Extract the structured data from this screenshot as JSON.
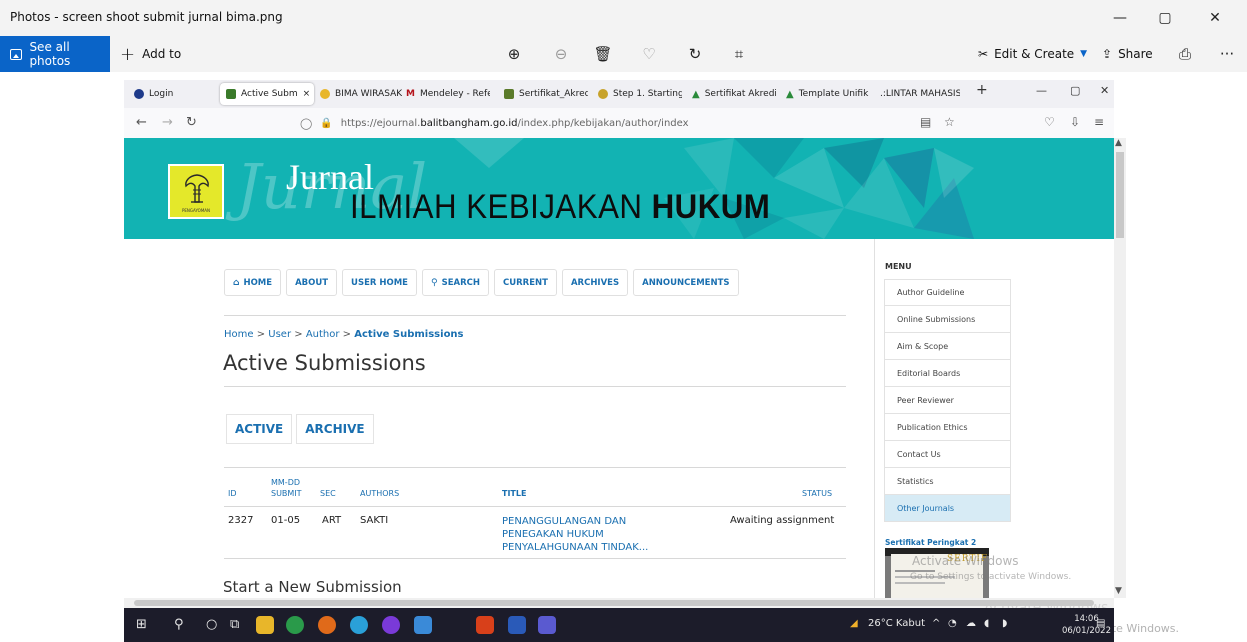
{
  "photos_app": {
    "title": "Photos - screen shoot submit jurnal bima.png",
    "minimize": "—",
    "restore": "▢",
    "close": "✕",
    "see_all": "See all photos",
    "add_to": "Add to",
    "edit_create": "Edit & Create",
    "share": "Share",
    "more": "···"
  },
  "browser": {
    "tabs": [
      {
        "label": "Login",
        "color": "#1e3a8a"
      },
      {
        "label": "Active Subm",
        "color": "#3a7a2a",
        "active": true
      },
      {
        "label": "BIMA WIRASAK",
        "color": "#2fb86a"
      },
      {
        "label": "Mendeley - Refe",
        "color": "#b4131b"
      },
      {
        "label": "Sertifikat_Akred",
        "color": "#5a7a2a"
      },
      {
        "label": "Step 1. Starting",
        "color": "#c7a22a"
      },
      {
        "label": "Sertifikat Akredi",
        "color": "#2a8a3a"
      },
      {
        "label": "Template Unifik",
        "color": "#2a8a3a"
      },
      {
        "label": ".:LINTAR MAHASISW",
        "color": "#f0f0f4"
      }
    ],
    "tab_close": "×",
    "new_tab": "+",
    "url_prefix": "https://ejournal.",
    "url_host": "balitbangham.go.id",
    "url_path": "/index.php/kebijakan/author/index"
  },
  "banner": {
    "script_word": "Jurnal",
    "word": "Jurnal",
    "sub_light": "ILMIAH KEBIJAKAN ",
    "sub_bold": "HUKUM",
    "logo_caption": "PENGAYOMAN"
  },
  "nav": [
    {
      "label": "HOME",
      "icon": "home-icon"
    },
    {
      "label": "ABOUT"
    },
    {
      "label": "USER HOME"
    },
    {
      "label": "SEARCH",
      "icon": "search-icon"
    },
    {
      "label": "CURRENT"
    },
    {
      "label": "ARCHIVES"
    },
    {
      "label": "ANNOUNCEMENTS"
    }
  ],
  "breadcrumb": {
    "home": "Home",
    "user": "User",
    "author": "Author",
    "current": "Active Submissions",
    "sep": " > "
  },
  "page_title": "Active Submissions",
  "subtabs": {
    "active": "ACTIVE",
    "archive": "ARCHIVE"
  },
  "table": {
    "headers": {
      "id": "ID",
      "submit_1": "MM-DD",
      "submit_2": "SUBMIT",
      "sec": "SEC",
      "authors": "AUTHORS",
      "title": "TITLE",
      "status": "STATUS"
    },
    "rows": [
      {
        "id": "2327",
        "submit": "01-05",
        "sec": "ART",
        "authors": "SAKTI",
        "title_1": "PENANGGULANGAN DAN",
        "title_2": "PENEGAKAN HUKUM",
        "title_3": "PENYALAHGUNAAN TINDAK...",
        "status": "Awaiting assignment"
      }
    ]
  },
  "new_submission": "Start a New Submission",
  "sidebar": {
    "menu_title": "MENU",
    "items": [
      "Author Guideline",
      "Online Submissions",
      "Aim & Scope",
      "Editorial Boards",
      "Peer Reviewer",
      "Publication Ethics",
      "Contact Us",
      "Statistics",
      "Other Journals"
    ],
    "cert_heading": "Sertifikat Peringkat 2",
    "cert_title": "SERTIFIKAT"
  },
  "watermark": {
    "line1": "Activate Windows",
    "line2": "Go to Settings to activate Windows."
  },
  "taskbar": {
    "weather": "26°C  Kabut",
    "time": "14:06",
    "date": "06/01/2022"
  },
  "colors": {
    "accent": "#0a64c8",
    "banner": "#12b3b3",
    "link": "#1a6fb0"
  }
}
